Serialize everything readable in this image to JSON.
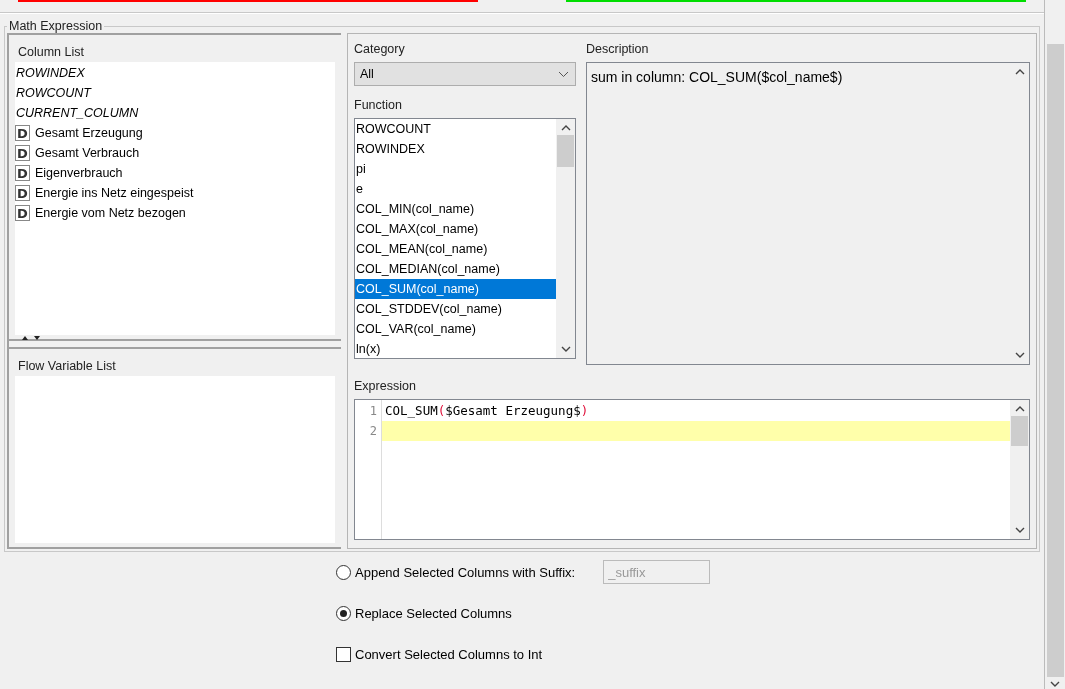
{
  "top_bars": [
    {
      "color": "#ff0000"
    },
    {
      "color": "#00dd00"
    }
  ],
  "group": {
    "title": "Math Expression"
  },
  "column_list": {
    "title": "Column List",
    "items": [
      {
        "kind": "variable",
        "label": "ROWINDEX"
      },
      {
        "kind": "variable",
        "label": "ROWCOUNT"
      },
      {
        "kind": "variable",
        "label": "CURRENT_COLUMN"
      },
      {
        "kind": "column",
        "type_badge": "D",
        "label": "Gesamt Erzeugung"
      },
      {
        "kind": "column",
        "type_badge": "D",
        "label": "Gesamt Verbrauch"
      },
      {
        "kind": "column",
        "type_badge": "D",
        "label": "Eigenverbrauch"
      },
      {
        "kind": "column",
        "type_badge": "D",
        "label": "Energie ins Netz eingespeist"
      },
      {
        "kind": "column",
        "type_badge": "D",
        "label": "Energie vom Netz bezogen"
      }
    ]
  },
  "flow_variable_list": {
    "title": "Flow Variable List"
  },
  "category": {
    "label": "Category",
    "value": "All"
  },
  "function": {
    "label": "Function",
    "items": [
      {
        "label": "ROWCOUNT",
        "selected": false
      },
      {
        "label": "ROWINDEX",
        "selected": false
      },
      {
        "label": "pi",
        "selected": false
      },
      {
        "label": "e",
        "selected": false
      },
      {
        "label": "COL_MIN(col_name)",
        "selected": false
      },
      {
        "label": "COL_MAX(col_name)",
        "selected": false
      },
      {
        "label": "COL_MEAN(col_name)",
        "selected": false
      },
      {
        "label": "COL_MEDIAN(col_name)",
        "selected": false
      },
      {
        "label": "COL_SUM(col_name)",
        "selected": true
      },
      {
        "label": "COL_STDDEV(col_name)",
        "selected": false
      },
      {
        "label": "COL_VAR(col_name)",
        "selected": false
      },
      {
        "label": "ln(x)",
        "selected": false
      }
    ]
  },
  "description": {
    "label": "Description",
    "text": "sum in column: COL_SUM($col_name$)"
  },
  "expression": {
    "label": "Expression",
    "lines": [
      {
        "number": "1",
        "current": false,
        "tokens": [
          {
            "kind": "plain",
            "text": "COL_SUM"
          },
          {
            "kind": "paren",
            "text": "("
          },
          {
            "kind": "plain",
            "text": "$Gesamt Erzeugung$"
          },
          {
            "kind": "paren",
            "text": ")"
          }
        ]
      },
      {
        "number": "2",
        "current": true
      }
    ]
  },
  "options": [
    {
      "kind": "radio",
      "label": "Append Selected Columns with Suffix:",
      "selected": false,
      "suffix_field": {
        "value": "_suffix",
        "disabled": true
      }
    },
    {
      "kind": "radio",
      "label": "Replace Selected Columns",
      "selected": true
    },
    {
      "kind": "checkbox",
      "label": "Convert Selected Columns to Int",
      "checked": false
    }
  ]
}
